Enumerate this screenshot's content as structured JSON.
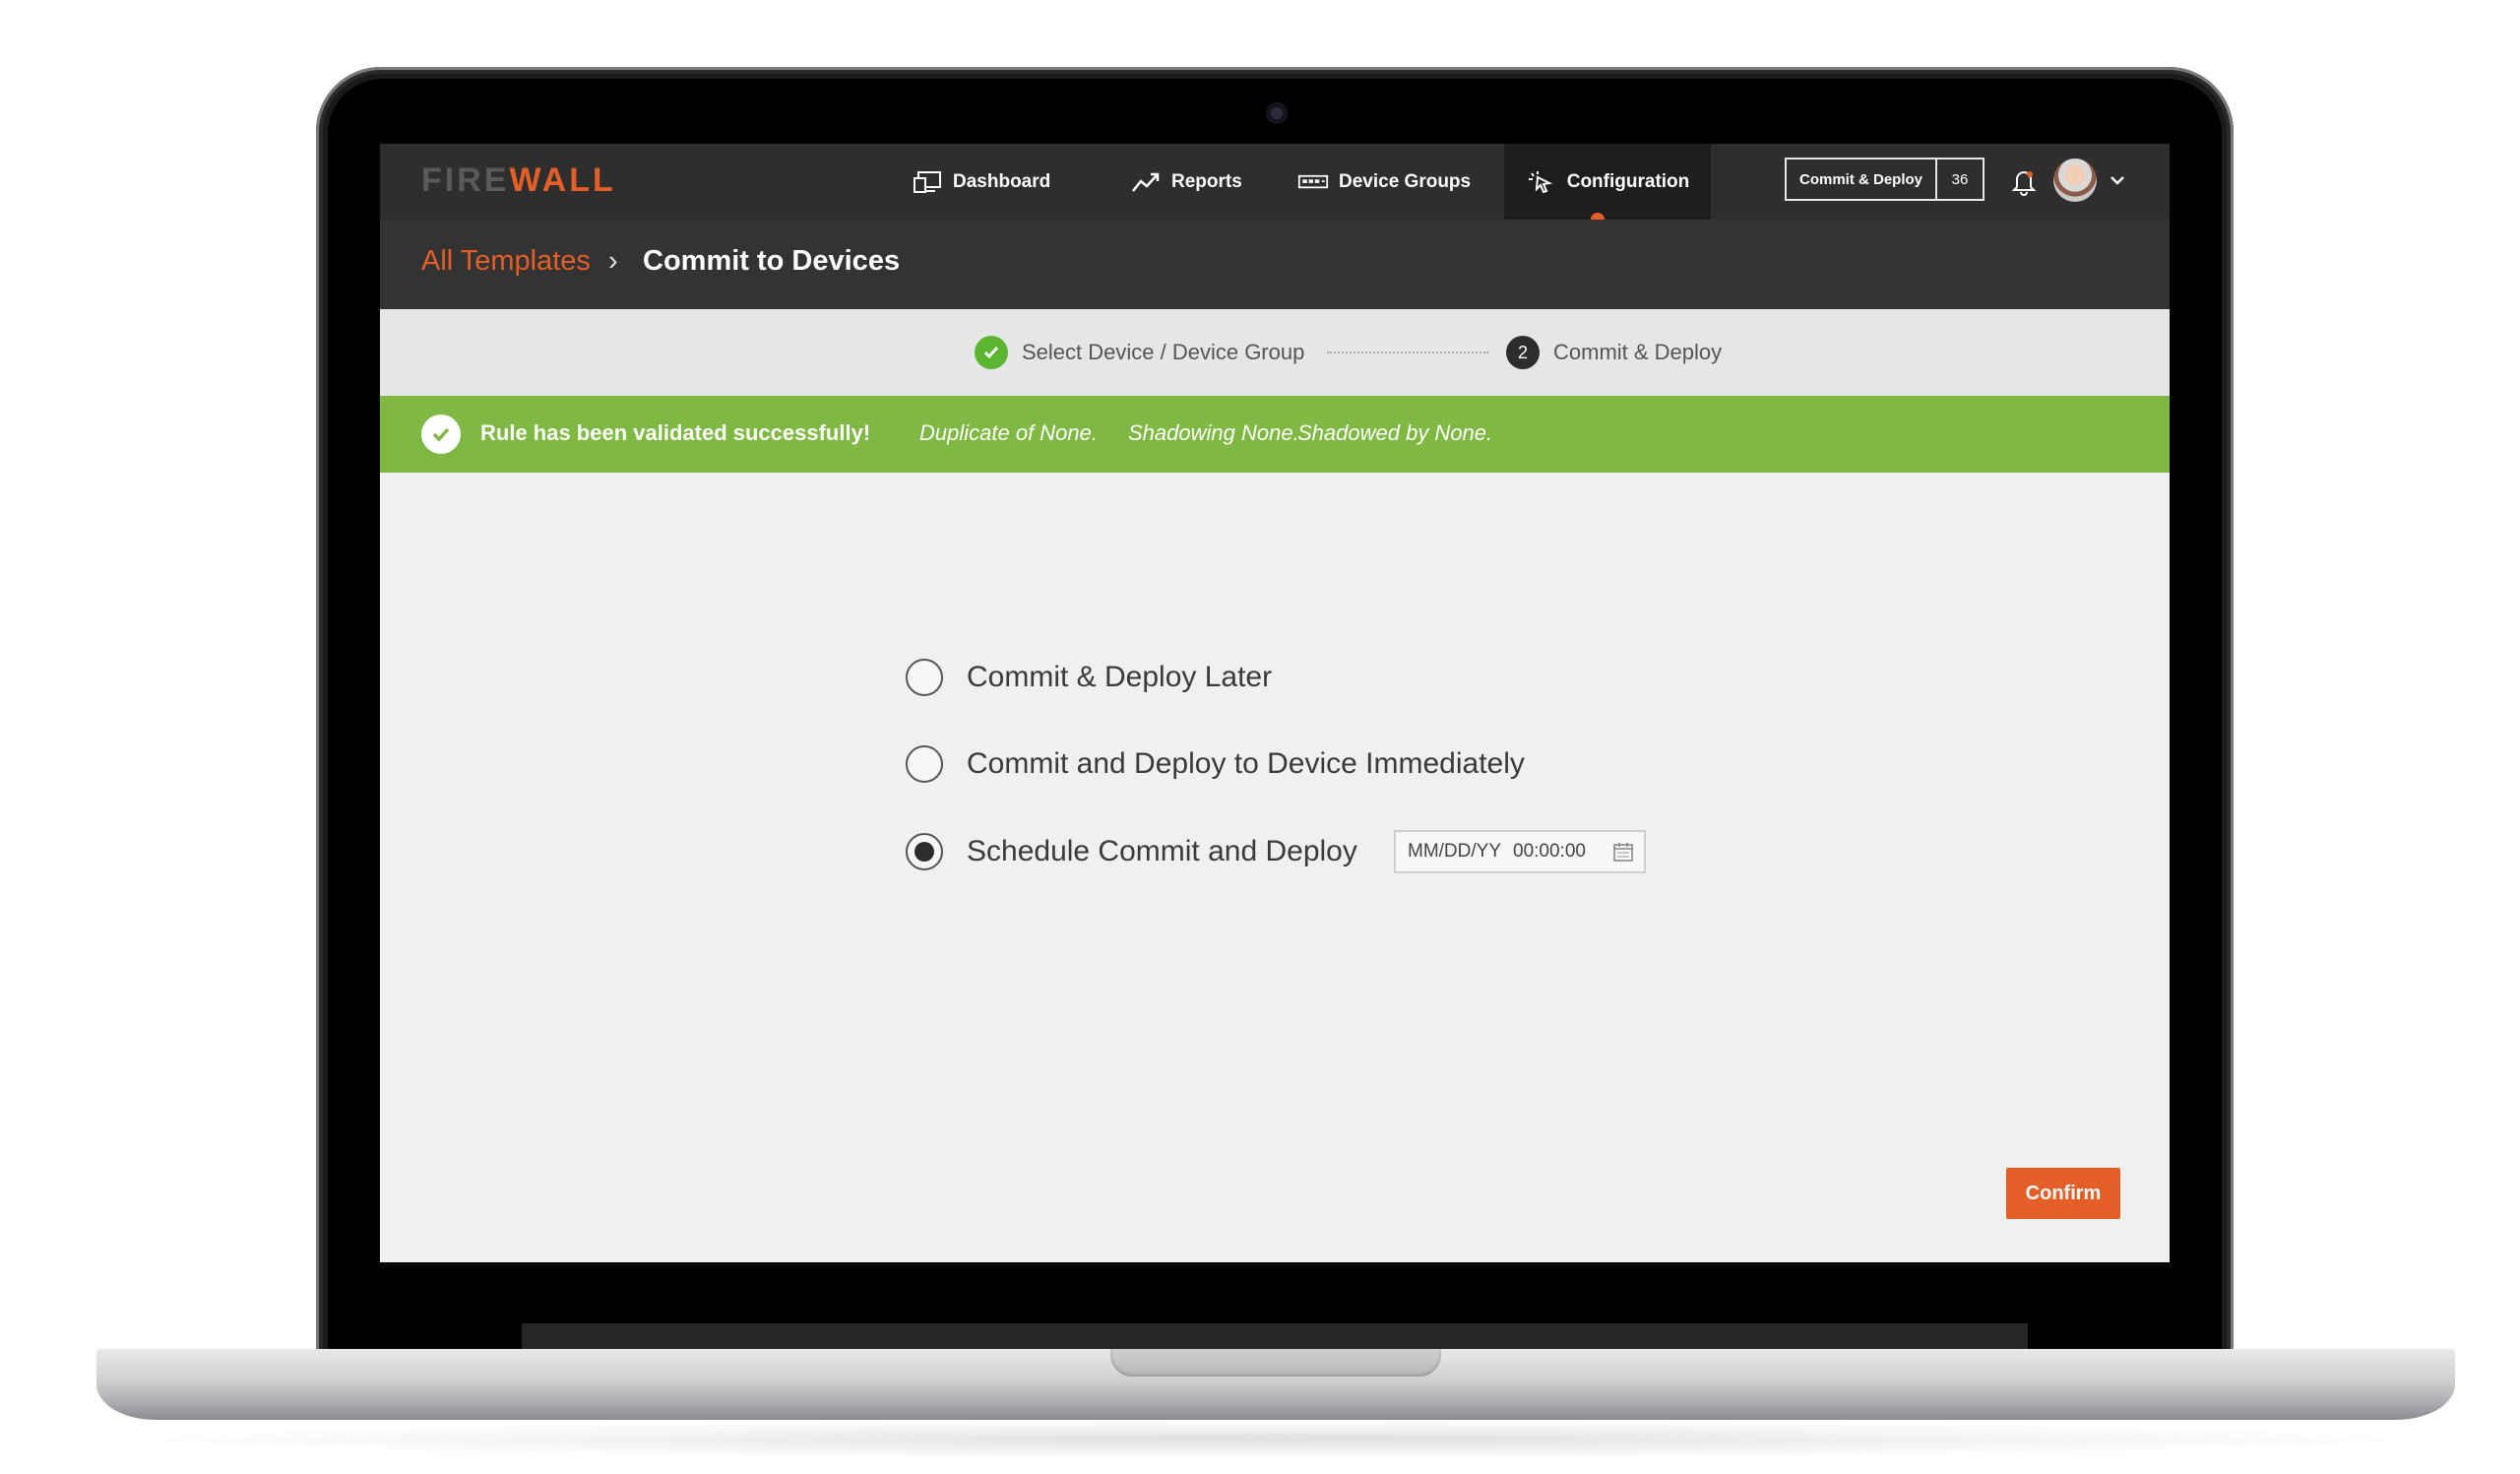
{
  "brand": {
    "part1": "FIRE",
    "part2": "WALL"
  },
  "nav": [
    {
      "label": "Dashboard",
      "icon": "dashboard-icon"
    },
    {
      "label": "Reports",
      "icon": "reports-icon"
    },
    {
      "label": "Device Groups",
      "icon": "device-groups-icon"
    },
    {
      "label": "Configuration",
      "icon": "configuration-icon",
      "active": true
    }
  ],
  "header": {
    "commit_label": "Commit & Deploy",
    "commit_count": "36"
  },
  "breadcrumb": {
    "link": "All Templates",
    "separator": "›",
    "current": "Commit to Devices"
  },
  "steps": [
    {
      "label": "Select Device / Device Group",
      "status": "complete"
    },
    {
      "number": "2",
      "label": "Commit & Deploy",
      "status": "current"
    }
  ],
  "banner": {
    "title": "Rule has been validated successfully!",
    "details": [
      "Duplicate of None.",
      "Shadowing None.",
      "Shadowed by None."
    ]
  },
  "options": [
    {
      "label": "Commit & Deploy Later",
      "selected": false
    },
    {
      "label": "Commit and Deploy to Device Immediately",
      "selected": false
    },
    {
      "label": "Schedule Commit and Deploy",
      "selected": true
    }
  ],
  "schedule": {
    "date_placeholder": "MM/DD/YY",
    "time": "00:00:00"
  },
  "actions": {
    "confirm": "Confirm"
  },
  "colors": {
    "accent": "#e35f27",
    "success": "#7fb843",
    "step_done": "#5cb531",
    "nav_bg": "#2e2e2e"
  }
}
